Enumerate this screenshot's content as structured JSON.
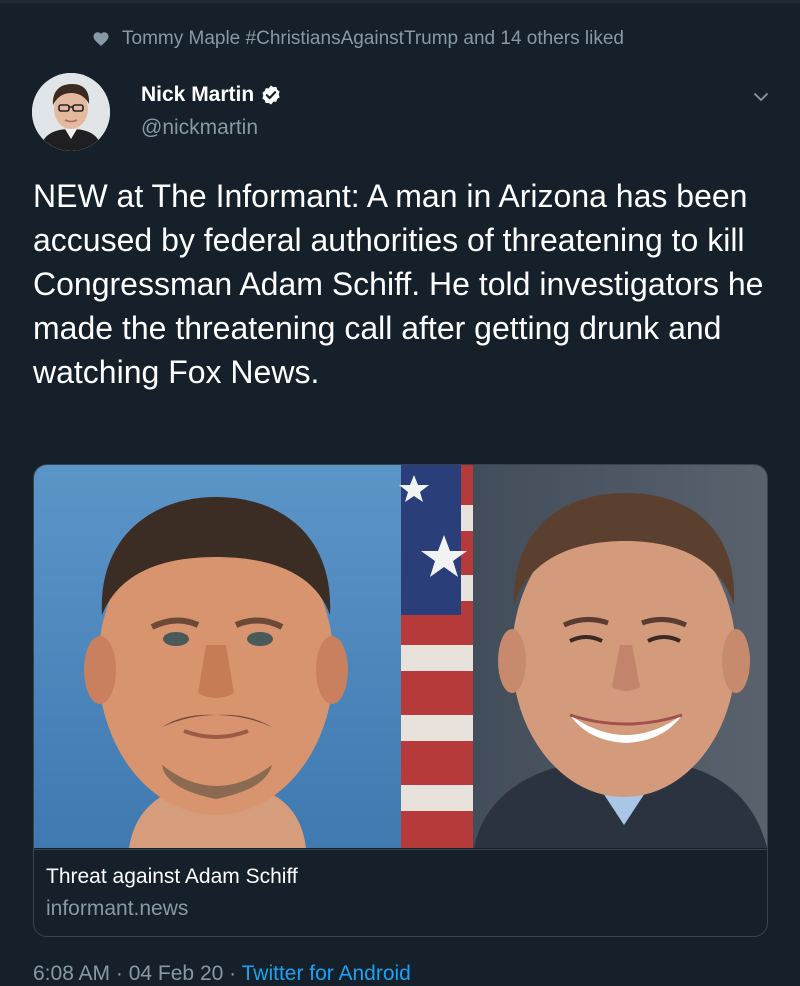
{
  "social_context": {
    "icon": "heart-icon",
    "text": "Tommy Maple #ChristiansAgainstTrump and 14 others liked"
  },
  "author": {
    "name": "Nick Martin",
    "handle": "@nickmartin",
    "verified_icon": "verified-badge-icon"
  },
  "tweet": {
    "text": "NEW at The Informant: A man in Arizona has been accused by federal authorities of threatening to kill Congressman Adam Schiff. He told investigators he made the threatening call after getting drunk and watching Fox News."
  },
  "card": {
    "title": "Threat against Adam Schiff",
    "domain": "informant.news"
  },
  "footer": {
    "time": "6:08 AM",
    "separator1": " · ",
    "date": "04 Feb 20",
    "separator2": " · ",
    "source": "Twitter for Android"
  },
  "colors": {
    "background": "#15202b",
    "secondary_text": "#8899a6",
    "link": "#1da1f2",
    "border": "#38444d"
  }
}
